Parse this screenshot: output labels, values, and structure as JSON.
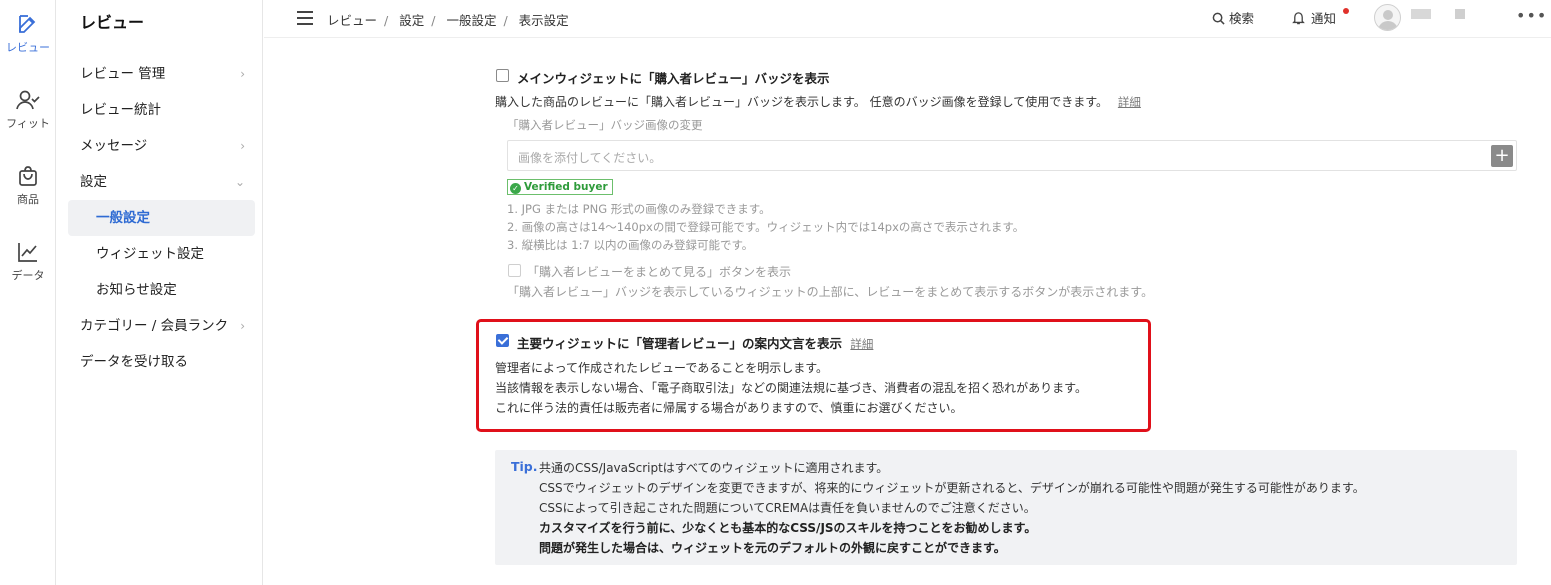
{
  "rail": {
    "items": [
      {
        "label": "レビュー",
        "icon": "edit-icon"
      },
      {
        "label": "フィット",
        "icon": "user-check-icon"
      },
      {
        "label": "商品",
        "icon": "shopping-bag-icon"
      },
      {
        "label": "データ",
        "icon": "chart-line-icon"
      }
    ],
    "accent": "#3a6fd8"
  },
  "sidebar": {
    "title": "レビュー",
    "items": [
      {
        "label": "レビュー 管理"
      },
      {
        "label": "レビュー統計"
      },
      {
        "label": "メッセージ"
      },
      {
        "label": "設定"
      },
      {
        "label": "一般設定"
      },
      {
        "label": "ウィジェット設定"
      },
      {
        "label": "お知らせ設定"
      },
      {
        "label": "カテゴリー / 会員ランク"
      },
      {
        "label": "データを受け取る"
      }
    ]
  },
  "header": {
    "breadcrumb": [
      "レビュー",
      "設定",
      "一般設定",
      "表示設定"
    ],
    "search_label": "検索",
    "notify_label": "通知",
    "more": "•••"
  },
  "main": {
    "buyer_badge": {
      "label": "メインウィジェットに「購入者レビュー」バッジを表示",
      "checked": false,
      "desc": "購入した商品のレビューに「購入者レビュー」バッジを表示します。 任意のバッジ画像を登録して使用できます。",
      "detail_link": "詳細",
      "image_label": "「購入者レビュー」バッジ画像の変更",
      "image_placeholder": "画像を添付してください。",
      "add_button": "+",
      "badge_preview": "Verified buyer",
      "notes": [
        "1. JPG または PNG 形式の画像のみ登録できます。",
        "2. 画像の高さは14～140pxの間で登録可能です。ウィジェット内では14pxの高さで表示されます。",
        "3. 縦横比は 1:7 以内の画像のみ登録可能です。"
      ],
      "view_all_label": "「購入者レビューをまとめて見る」ボタンを表示",
      "view_all_checked": false,
      "view_all_desc": "「購入者レビュー」バッジを表示しているウィジェットの上部に、レビューをまとめて表示するボタンが表示されます。"
    },
    "admin_review": {
      "label": "主要ウィジェットに「管理者レビュー」の案内文言を表示",
      "checked": true,
      "detail_link": "詳細",
      "lines": [
        "管理者によって作成されたレビューであることを明示します。",
        "当該情報を表示しない場合、「電子商取引法」などの関連法規に基づき、消費者の混乱を招く恐れがあります。",
        "これに伴う法的責任は販売者に帰属する場合がありますので、慎重にお選びください。"
      ],
      "highlight_color": "#e0101a"
    },
    "tip": {
      "label": "Tip.",
      "lines": [
        "共通のCSS/JavaScriptはすべてのウィジェットに適用されます。",
        "CSSでウィジェットのデザインを変更できますが、将来的にウィジェットが更新されると、デザインが崩れる可能性や問題が発生する可能性があります。",
        "CSSによって引き起こされた問題についてCREMAは責任を負いませんのでご注意ください。",
        "カスタマイズを行う前に、少なくとも基本的なCSS/JSのスキルを持つことをお勧めします。",
        "問題が発生した場合は、ウィジェットを元のデフォルトの外観に戻すことができます。"
      ]
    }
  }
}
